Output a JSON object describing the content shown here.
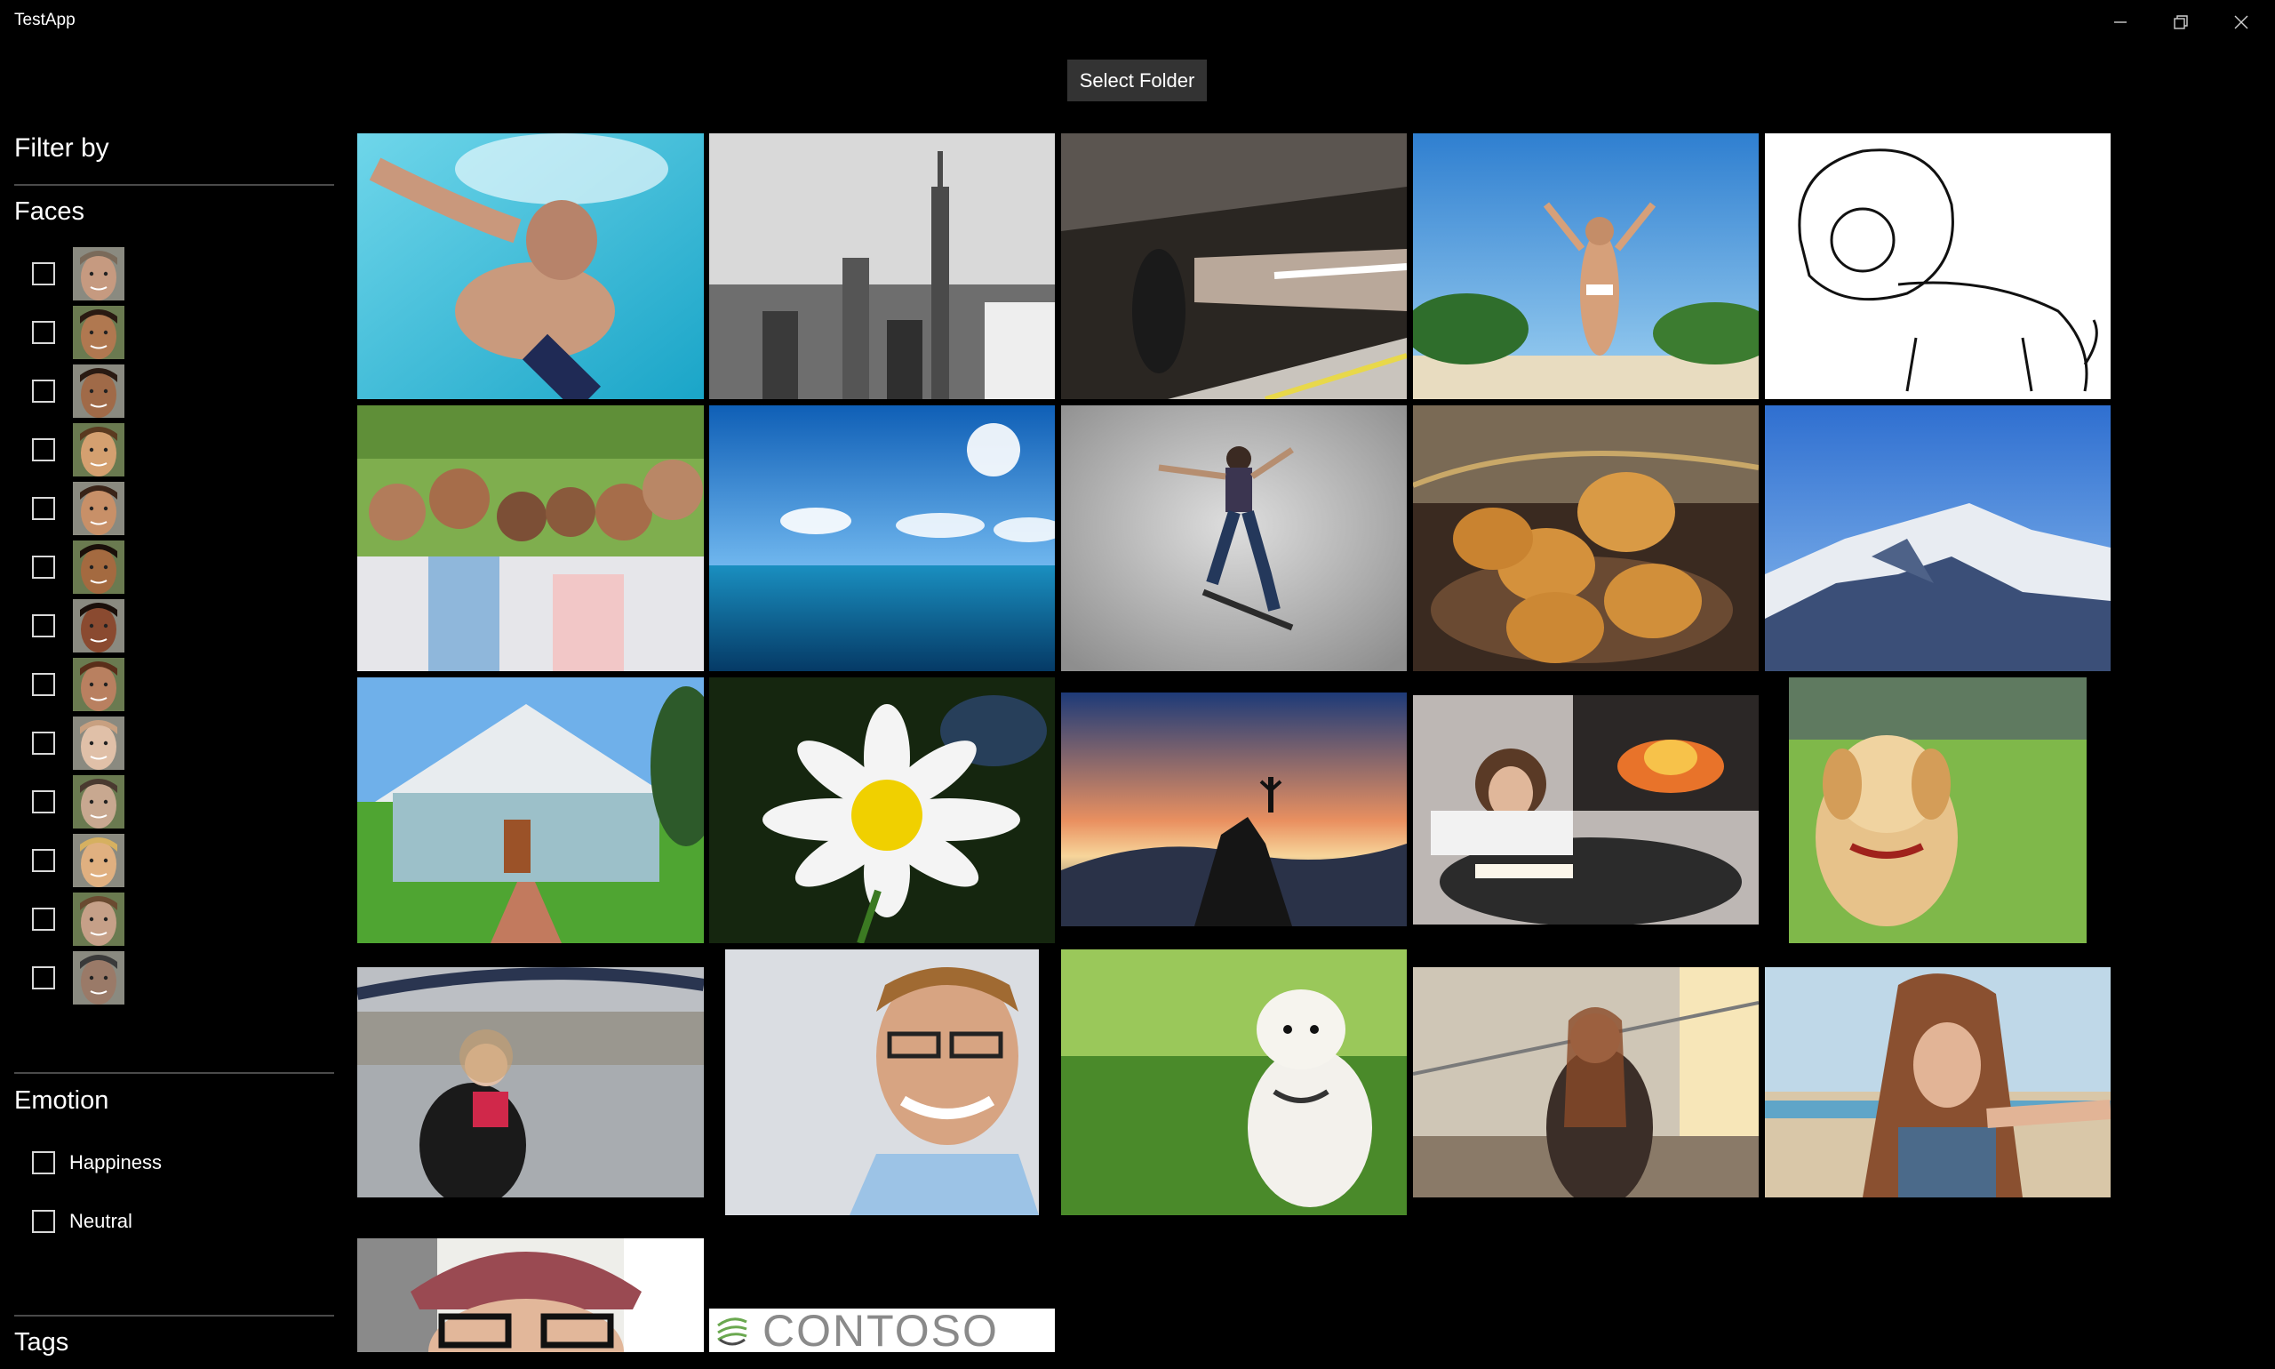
{
  "window": {
    "title": "TestApp"
  },
  "toolbar": {
    "select_folder_label": "Select Folder"
  },
  "sidebar": {
    "filter_title": "Filter by",
    "faces_title": "Faces",
    "faces_count": 13,
    "emotion_title": "Emotion",
    "emotions": [
      {
        "label": "Happiness",
        "checked": false
      },
      {
        "label": "Neutral",
        "checked": false
      }
    ],
    "tags_title": "Tags"
  },
  "gallery": {
    "contoso_label": "CONTOSO",
    "images": [
      "swimmer",
      "city-skyline-bw",
      "subway-platform",
      "woman-on-beach",
      "lion-line-drawing",
      "family-portrait",
      "ocean-horizon",
      "skateboarder",
      "bread-rolls",
      "snowy-mountain",
      "suburban-house",
      "daisy-flower",
      "mountain-sunset-silhouette",
      "woman-reading-by-fireplace",
      "golden-puppy",
      "woman-by-river",
      "smiling-man-glasses",
      "white-puppy",
      "woman-on-balcony",
      "woman-selfie-beach",
      "man-with-beanie",
      "contoso-logo"
    ]
  }
}
